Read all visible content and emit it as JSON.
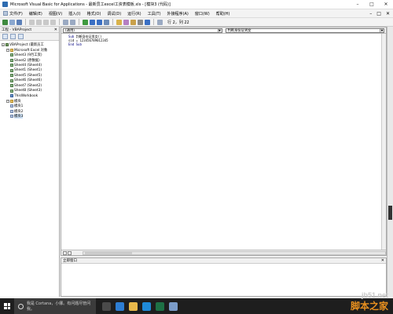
{
  "window": {
    "title": "Microsoft Visual Basic for Applications - 最新员工excel工资表模板.xls - [模块3 (代码)]",
    "controls": [
      "–",
      "□",
      "✕"
    ]
  },
  "menubar": {
    "items": [
      "文件(F)",
      "编辑(E)",
      "视图(V)",
      "插入(I)",
      "格式(O)",
      "调试(D)",
      "运行(R)",
      "工具(T)",
      "外接程序(A)",
      "窗口(W)",
      "帮助(H)"
    ],
    "right_controls": [
      "–",
      "□",
      "✕"
    ]
  },
  "toolbar": {
    "position_label": "行 2，列 22"
  },
  "project_pane": {
    "title": "工程 - VBAProject",
    "close": "✕",
    "tree": [
      {
        "label": "VBAProject (最新员工",
        "level": 0,
        "icon": "proj",
        "expand": "−"
      },
      {
        "label": "Microsoft Excel 对象",
        "level": 1,
        "icon": "folder",
        "expand": "−"
      },
      {
        "label": "Sheet3 (9月工资)",
        "level": 2,
        "icon": "sheet"
      },
      {
        "label": "Sheet2 (原数据)",
        "level": 2,
        "icon": "sheet"
      },
      {
        "label": "Sheet4 (Sheet4)",
        "level": 2,
        "icon": "sheet"
      },
      {
        "label": "Sheet1 (Sheet1)",
        "level": 2,
        "icon": "sheet"
      },
      {
        "label": "Sheet5 (Sheet5)",
        "level": 2,
        "icon": "sheet"
      },
      {
        "label": "Sheet6 (Sheet6)",
        "level": 2,
        "icon": "sheet"
      },
      {
        "label": "Sheet7 (Sheet2)",
        "level": 2,
        "icon": "sheet"
      },
      {
        "label": "Sheet8 (Sheet3)",
        "level": 2,
        "icon": "sheet"
      },
      {
        "label": "ThisWorkbook",
        "level": 2,
        "icon": "wb"
      },
      {
        "label": "模块",
        "level": 1,
        "icon": "folder",
        "expand": "−"
      },
      {
        "label": "模块1",
        "level": 2,
        "icon": "mod"
      },
      {
        "label": "模块2",
        "level": 2,
        "icon": "mod"
      },
      {
        "label": "模块3",
        "level": 2,
        "icon": "mod"
      }
    ]
  },
  "code_window": {
    "object_combo": "(通用)",
    "proc_combo": "判断身份证男女",
    "combo_arrow": "▼",
    "lines": [
      {
        "kw": "Sub",
        "rest": " 判断身份证男女()"
      },
      {
        "kw": "",
        "rest": "sid = 123456789012345"
      },
      {
        "kw": "End Sub",
        "rest": ""
      }
    ]
  },
  "immediate_window": {
    "title": "立即窗口",
    "close": "✕"
  },
  "taskbar": {
    "search_placeholder": "我是 Cortana，小娜。有问题尽管问我。"
  },
  "watermark": {
    "site": "jb51.net",
    "name": "脚本之家"
  },
  "colors": {
    "keyword": "#00007f",
    "taskbar": "#1e1e1e",
    "watermark": "#e8901f"
  }
}
